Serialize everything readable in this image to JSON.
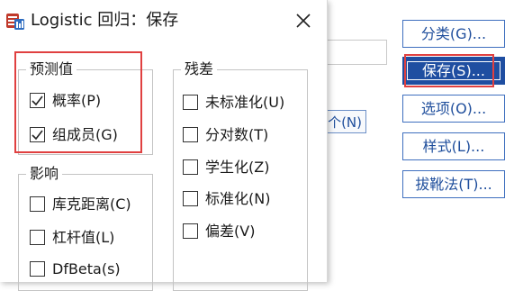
{
  "window": {
    "title": "Logistic 回归：保存"
  },
  "groups": {
    "predicted": {
      "legend": "预测值",
      "items": [
        {
          "label": "概率(P)",
          "checked": true
        },
        {
          "label": "组成员(G)",
          "checked": true
        }
      ]
    },
    "influence": {
      "legend": "影响",
      "items": [
        {
          "label": "库克距离(C)",
          "checked": false
        },
        {
          "label": "杠杆值(L)",
          "checked": false
        },
        {
          "label": "DfBeta(s)",
          "checked": false
        }
      ]
    },
    "residuals": {
      "legend": "残差",
      "items": [
        {
          "label": "未标准化(U)",
          "checked": false
        },
        {
          "label": "分对数(T)",
          "checked": false
        },
        {
          "label": "学生化(Z)",
          "checked": false
        },
        {
          "label": "标准化(N)",
          "checked": false
        },
        {
          "label": "偏差(V)",
          "checked": false
        }
      ]
    }
  },
  "background": {
    "partial_button": "个(N)"
  },
  "side_buttons": [
    {
      "label": "分类(G)...",
      "active": false
    },
    {
      "label": "保存(S)...",
      "active": true
    },
    {
      "label": "选项(O)...",
      "active": false
    },
    {
      "label": "样式(L)...",
      "active": false
    },
    {
      "label": "拔靴法(T)...",
      "active": false
    }
  ],
  "colors": {
    "accent": "#1f4ea1",
    "highlight": "#e04040"
  }
}
